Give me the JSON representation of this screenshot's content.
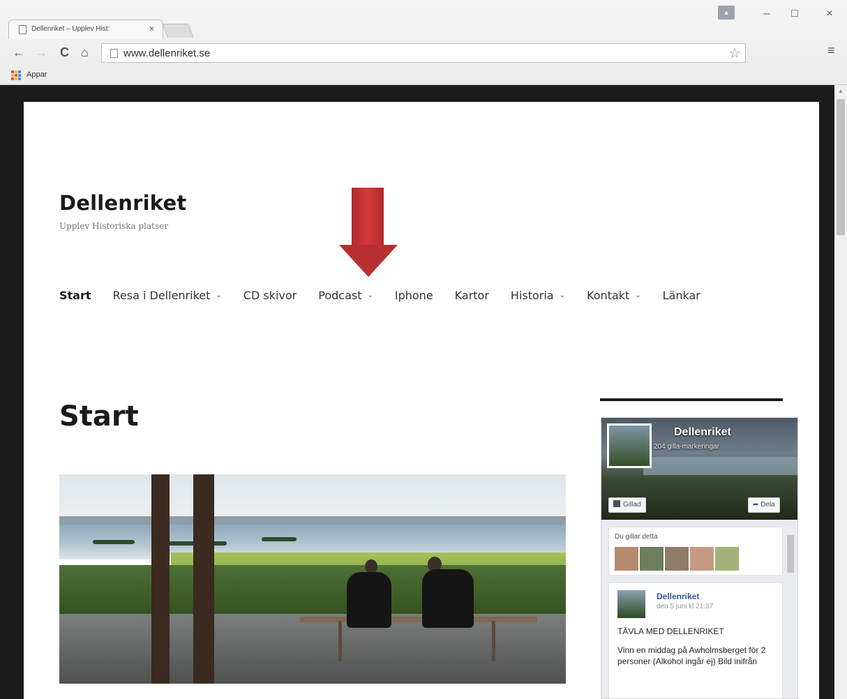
{
  "browser": {
    "tab_title": "Dellenriket – Upplev Hist:",
    "tab_close": "×",
    "url": "www.dellenriket.se",
    "window_controls": {
      "minimize": "–",
      "maximize": "□",
      "close": "×"
    },
    "nav": {
      "back": "←",
      "forward": "→",
      "reload": "C",
      "home": "⌂"
    },
    "star": "☆",
    "menu": "≡",
    "bookmarks": [
      {
        "label": "Appar",
        "icon": "apps-grid-icon"
      }
    ]
  },
  "site": {
    "title": "Dellenriket",
    "tagline": "Upplev Historiska platser"
  },
  "nav": {
    "items": [
      {
        "label": "Start",
        "current": true,
        "dropdown": false,
        "chev": ""
      },
      {
        "label": "Resa i Dellenriket",
        "current": false,
        "dropdown": true,
        "chev": "⌄"
      },
      {
        "label": "CD skivor",
        "current": false,
        "dropdown": false,
        "chev": ""
      },
      {
        "label": "Podcast",
        "current": false,
        "dropdown": true,
        "chev": "⌄"
      },
      {
        "label": "Iphone",
        "current": false,
        "dropdown": false,
        "chev": ""
      },
      {
        "label": "Kartor",
        "current": false,
        "dropdown": false,
        "chev": ""
      },
      {
        "label": "Historia",
        "current": false,
        "dropdown": true,
        "chev": "⌄"
      },
      {
        "label": "Kontakt",
        "current": false,
        "dropdown": true,
        "chev": "⌄"
      },
      {
        "label": "Länkar",
        "current": false,
        "dropdown": false,
        "chev": ""
      }
    ]
  },
  "annotation": {
    "color": "#c0312f",
    "points_to": "Podcast"
  },
  "main": {
    "title": "Start"
  },
  "facebook": {
    "page_name": "Dellenriket",
    "likes": "204 gilla-markeringar",
    "liked_button": "Gillad",
    "share_button": "Dela",
    "friends_label": "Du gillar detta",
    "friend_colors": [
      "#b68a6e",
      "#6c7f5a",
      "#8f7d6a",
      "#c49a83",
      "#a3b07a"
    ],
    "post": {
      "author": "Dellenriket",
      "date": "den 5 juni kl 21:37",
      "headline": "TÄVLA MED DELLENRIKET",
      "text": "Vinn en middag på Awholmsberget för 2 personer (Alkohol ingår ej) Bild inifrån"
    }
  }
}
